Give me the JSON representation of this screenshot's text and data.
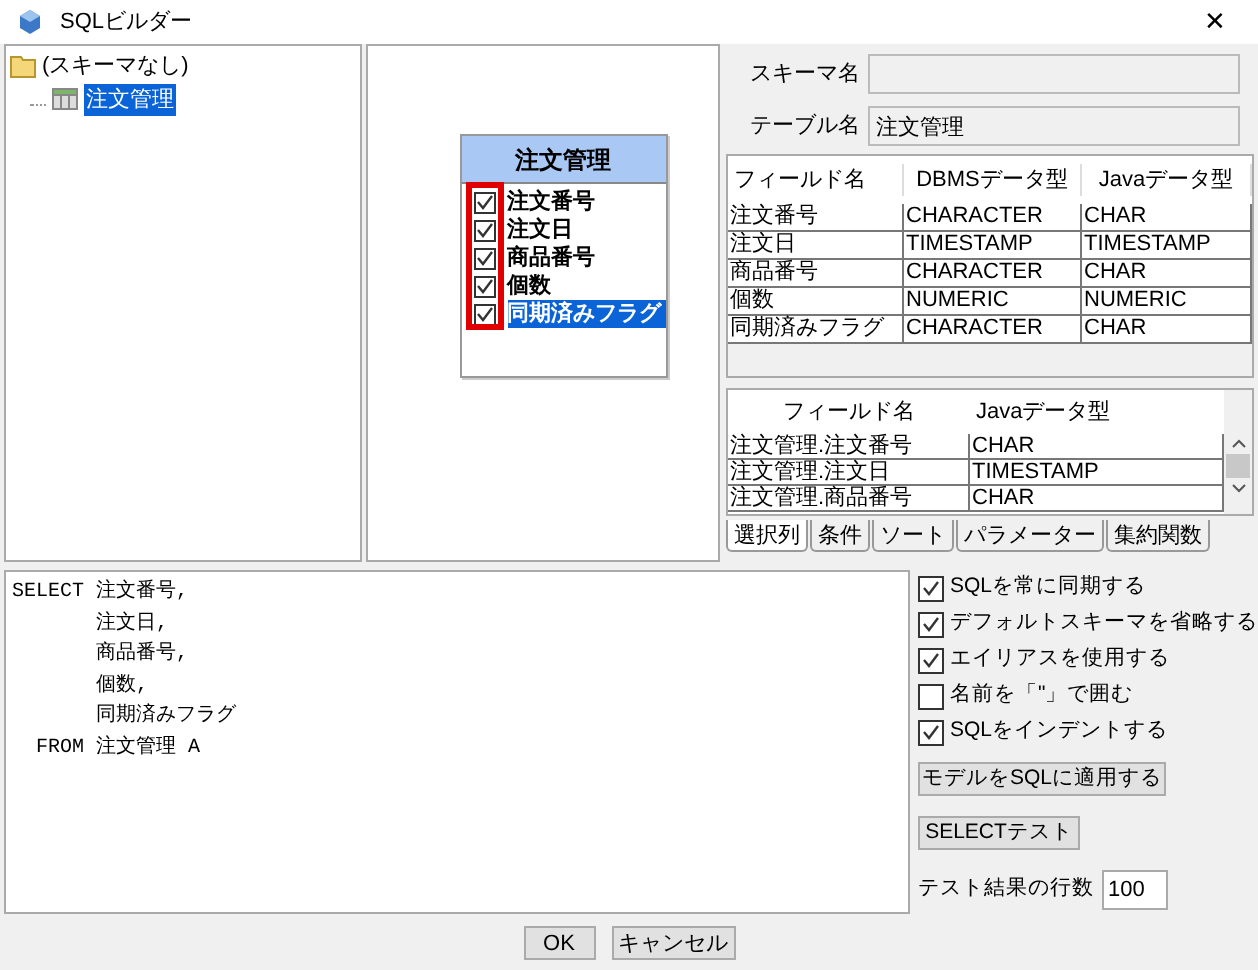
{
  "window": {
    "title": "SQLビルダー",
    "close": "✕"
  },
  "tree": {
    "label": "(スキーマなし)",
    "children": [
      {
        "label": "注文管理",
        "selected": true
      }
    ]
  },
  "diagram": {
    "table": "注文管理",
    "highlight": true,
    "fields": [
      {
        "label": "注文番号",
        "checked": true,
        "selected": false
      },
      {
        "label": "注文日",
        "checked": true,
        "selected": false
      },
      {
        "label": "商品番号",
        "checked": true,
        "selected": false
      },
      {
        "label": "個数",
        "checked": true,
        "selected": false
      },
      {
        "label": "同期済みフラグ",
        "checked": true,
        "selected": true
      }
    ]
  },
  "schema": {
    "label": "スキーマ名"
  },
  "table_name": {
    "label": "テーブル名",
    "value": "注文管理"
  },
  "fields_table": {
    "columns": [
      "フィールド名",
      "DBMSデータ型",
      "Javaデータ型"
    ],
    "rows": [
      [
        "注文番号",
        "CHARACTER",
        "CHAR"
      ],
      [
        "注文日",
        "TIMESTAMP",
        "TIMESTAMP"
      ],
      [
        "商品番号",
        "CHARACTER",
        "CHAR"
      ],
      [
        "個数",
        "NUMERIC",
        "NUMERIC"
      ],
      [
        "同期済みフラグ",
        "CHARACTER",
        "CHAR"
      ]
    ]
  },
  "selected_table": {
    "columns": [
      "フィールド名",
      "Javaデータ型"
    ],
    "rows": [
      [
        "注文管理.注文番号",
        "CHAR"
      ],
      [
        "注文管理.注文日",
        "TIMESTAMP"
      ],
      [
        "注文管理.商品番号",
        "CHAR"
      ]
    ]
  },
  "tabs": [
    {
      "label": "選択列",
      "selected": true
    },
    {
      "label": "条件",
      "selected": false
    },
    {
      "label": "ソート",
      "selected": false
    },
    {
      "label": "パラメーター",
      "selected": false
    },
    {
      "label": "集約関数",
      "selected": false
    }
  ],
  "sql": [
    "SELECT 注文番号,",
    "       注文日,",
    "       商品番号,",
    "       個数,",
    "       同期済みフラグ",
    "  FROM 注文管理 A"
  ],
  "options": [
    {
      "label": "SQLを常に同期する",
      "checked": true
    },
    {
      "label": "デフォルトスキーマを省略する",
      "checked": true
    },
    {
      "label": "エイリアスを使用する",
      "checked": true
    },
    {
      "label": "名前を「\"」で囲む",
      "checked": false
    },
    {
      "label": "SQLをインデントする",
      "checked": true
    }
  ],
  "apply_button": "モデルをSQLに適用する",
  "test_button": "SELECTテスト",
  "rows_count": {
    "label": "テスト結果の行数",
    "value": "100"
  },
  "buttons": [
    "OK",
    "キャンセル"
  ]
}
